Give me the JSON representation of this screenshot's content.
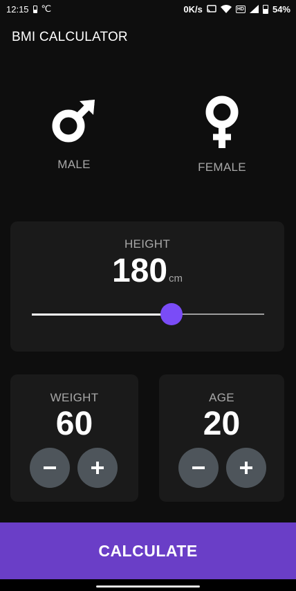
{
  "status_bar": {
    "time": "12:15",
    "temp_unit": "℃",
    "net_speed": "0K/s",
    "battery_percent": "54%",
    "icons": [
      "cast-icon",
      "wifi-icon",
      "hd-icon",
      "signal-icon",
      "battery-icon"
    ]
  },
  "app_bar": {
    "title": "BMI CALCULATOR"
  },
  "gender": {
    "male_label": "MALE",
    "female_label": "FEMALE"
  },
  "height": {
    "label": "HEIGHT",
    "value": "180",
    "unit": "cm",
    "slider_fraction": 0.6
  },
  "weight": {
    "label": "WEIGHT",
    "value": "60"
  },
  "age": {
    "label": "AGE",
    "value": "20"
  },
  "calculate_label": "CALCULATE",
  "colors": {
    "background": "#0e0e0e",
    "card": "#1a1a1a",
    "accent": "#7a4cf7",
    "button": "#6a3ec7",
    "stepper": "#4e555b",
    "label": "#a8a8a8"
  }
}
